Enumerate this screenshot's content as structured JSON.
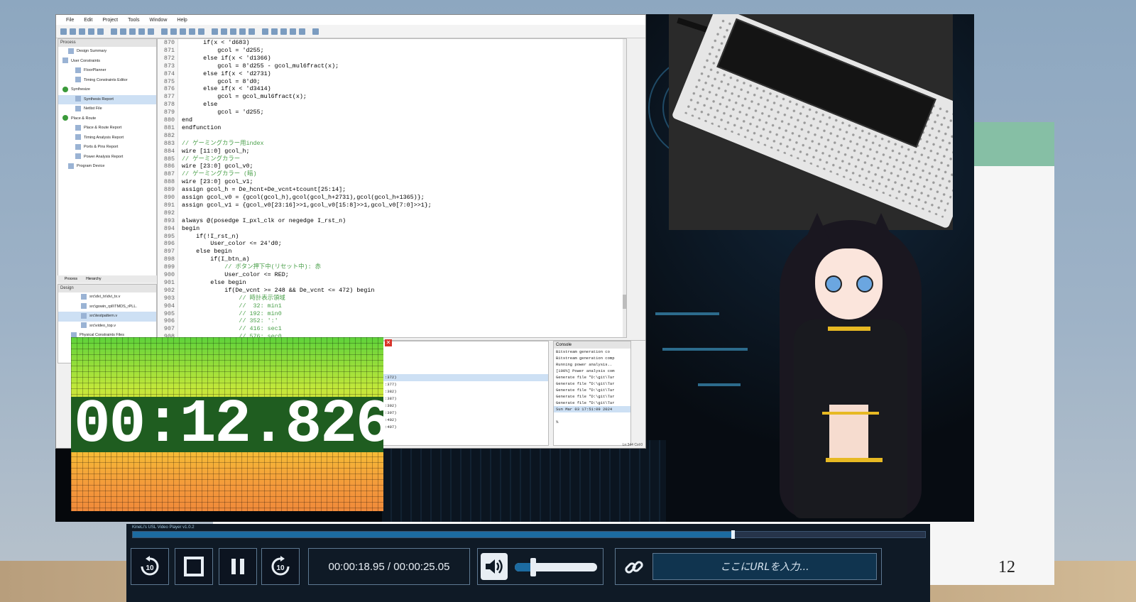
{
  "ide": {
    "menu": [
      "File",
      "Edit",
      "Project",
      "Tools",
      "Window",
      "Help"
    ],
    "process_title": "Process",
    "process_items": [
      {
        "label": "Design Summary",
        "status": "doc"
      },
      {
        "label": "User Constraints",
        "status": "folder"
      },
      {
        "label": "FloorPlanner",
        "status": "doc"
      },
      {
        "label": "Timing Constraints Editor",
        "status": "doc"
      },
      {
        "label": "Synthesize",
        "status": "ok"
      },
      {
        "label": "Synthesis Report",
        "status": "doc-selected"
      },
      {
        "label": "Netlist File",
        "status": "doc"
      },
      {
        "label": "Place & Route",
        "status": "ok"
      },
      {
        "label": "Place & Route Report",
        "status": "doc"
      },
      {
        "label": "Timing Analysis Report",
        "status": "doc"
      },
      {
        "label": "Ports & Pins Report",
        "status": "doc"
      },
      {
        "label": "Power Analysis Report",
        "status": "doc"
      },
      {
        "label": "Program Device",
        "status": "doc"
      }
    ],
    "pane_tabs": [
      "Process",
      "Hierarchy"
    ],
    "design_title": "Design",
    "design_items": [
      "src\\dvi_tx\\dvi_tx.v",
      "src\\gowin_rpll\\TMDS_rPLL.",
      "src\\testpattern.v",
      "src\\video_top.v",
      "Physical Constraints Files"
    ],
    "code_lines": [
      {
        "n": "870",
        "t": "      if(x < 'd683)"
      },
      {
        "n": "871",
        "t": "          gcol = 'd255;"
      },
      {
        "n": "872",
        "t": "      else if(x < 'd1366)"
      },
      {
        "n": "873",
        "t": "          gcol = 8'd255 - gcol_mul6fract(x);"
      },
      {
        "n": "874",
        "t": "      else if(x < 'd2731)"
      },
      {
        "n": "875",
        "t": "          gcol = 8'd0;"
      },
      {
        "n": "876",
        "t": "      else if(x < 'd3414)"
      },
      {
        "n": "877",
        "t": "          gcol = gcol_mul6fract(x);"
      },
      {
        "n": "878",
        "t": "      else"
      },
      {
        "n": "879",
        "t": "          gcol = 'd255;"
      },
      {
        "n": "880",
        "t": "end"
      },
      {
        "n": "881",
        "t": "endfunction"
      },
      {
        "n": "882",
        "t": ""
      },
      {
        "n": "883",
        "t": "// ゲーミングカラー用index"
      },
      {
        "n": "884",
        "t": "wire [11:0] gcol_h;"
      },
      {
        "n": "885",
        "t": "// ゲーミングカラー"
      },
      {
        "n": "886",
        "t": "wire [23:0] gcol_v0;"
      },
      {
        "n": "887",
        "t": "// ゲーミングカラー (暗)"
      },
      {
        "n": "888",
        "t": "wire [23:0] gcol_v1;"
      },
      {
        "n": "889",
        "t": "assign gcol_h = De_hcnt+De_vcnt+tcount[25:14];"
      },
      {
        "n": "890",
        "t": "assign gcol_v0 = {gcol(gcol_h),gcol(gcol_h+2731),gcol(gcol_h+1365)};"
      },
      {
        "n": "891",
        "t": "assign gcol_v1 = {gcol_v0[23:16]>>1,gcol_v0[15:8]>>1,gcol_v0[7:0]>>1};"
      },
      {
        "n": "892",
        "t": ""
      },
      {
        "n": "893",
        "t": "always @(posedge I_pxl_clk or negedge I_rst_n)"
      },
      {
        "n": "894",
        "t": "begin"
      },
      {
        "n": "895",
        "t": "    if(!I_rst_n)"
      },
      {
        "n": "896",
        "t": "        User_color <= 24'd0;"
      },
      {
        "n": "897",
        "t": "    else begin"
      },
      {
        "n": "898",
        "t": "        if(I_btn_a)"
      },
      {
        "n": "899",
        "t": "            // ボタン押下中(リセット中): 赤"
      },
      {
        "n": "900",
        "t": "            User_color <= RED;"
      },
      {
        "n": "901",
        "t": "        else begin"
      },
      {
        "n": "902",
        "t": "            if(De_vcnt >= 248 && De_vcnt <= 472) begin"
      },
      {
        "n": "903",
        "t": "                // 時計表示領域"
      },
      {
        "n": "904",
        "t": "                //  32: min1"
      },
      {
        "n": "905",
        "t": "                // 192: min0"
      },
      {
        "n": "906",
        "t": "                // 352: ':'"
      },
      {
        "n": "907",
        "t": "                // 416: sec1"
      },
      {
        "n": "908",
        "t": "                // 576: sec0"
      }
    ],
    "messages": [
      ":372)",
      ":377)",
      ":382)",
      ":387)",
      ":392)",
      ":397)",
      ":402)",
      ":407)"
    ],
    "console_title": "Console",
    "console_lines": [
      "Bitstream generation co",
      "Bitstream generation comp",
      "Running power analysis..",
      "[100%] Power analysis com",
      "Generate file \"D:\\git\\Tar",
      "Generate file \"D:\\git\\Tar",
      "Generate file \"D:\\git\\Tar",
      "Generate file \"D:\\git\\Tar",
      "Generate file \"D:\\git\\Tar",
      "Sun Mar 03 17:51:09 2024",
      "",
      "%"
    ],
    "status": "Ln:344  Col:0"
  },
  "clock": {
    "text": "00:12.826"
  },
  "player": {
    "title": "KineLi's USL Video Player v1.0.2",
    "time_current": "00:00:18.95",
    "time_total": "00:00:25.05",
    "seek_fraction": 0.757,
    "volume_fraction": 0.22,
    "url_placeholder": "ここにURLを入力..."
  },
  "slide": {
    "page_number": "12"
  },
  "colors": {
    "player_bg": "#0f1a26",
    "accent": "#1c6ba1",
    "clock_band": "#1f5d20"
  }
}
